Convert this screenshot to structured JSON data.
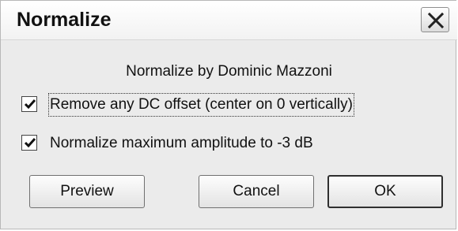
{
  "window": {
    "title": "Normalize",
    "close_icon": "close-icon"
  },
  "dialog": {
    "heading": "Normalize by Dominic Mazzoni",
    "options": [
      {
        "label": "Remove any DC offset (center on 0 vertically)",
        "checked": true
      },
      {
        "label": "Normalize maximum amplitude to -3 dB",
        "checked": true
      }
    ]
  },
  "buttons": {
    "preview": "Preview",
    "cancel": "Cancel",
    "ok": "OK"
  }
}
